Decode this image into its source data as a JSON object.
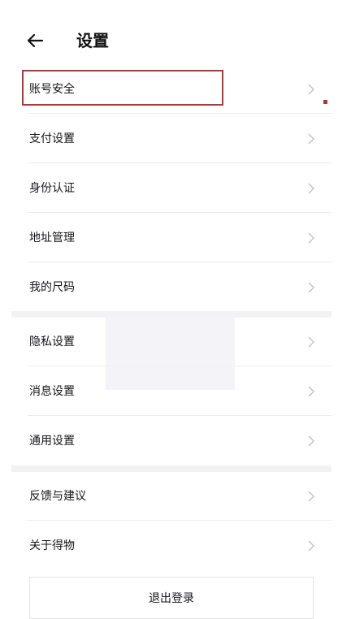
{
  "header": {
    "back_icon": "arrow-left-icon",
    "title": "设置"
  },
  "settings": {
    "items": [
      {
        "label": "账号安全"
      },
      {
        "label": "支付设置"
      },
      {
        "label": "身份认证"
      },
      {
        "label": "地址管理"
      },
      {
        "label": "我的尺码"
      },
      {
        "label": "隐私设置"
      },
      {
        "label": "消息设置"
      },
      {
        "label": "通用设置"
      },
      {
        "label": "反馈与建议"
      },
      {
        "label": "关于得物"
      }
    ]
  },
  "logout": {
    "label": "退出登录"
  },
  "colors": {
    "highlight": "#b0363a",
    "section_gap": "#f2f2f6",
    "divider": "#ececf0"
  }
}
